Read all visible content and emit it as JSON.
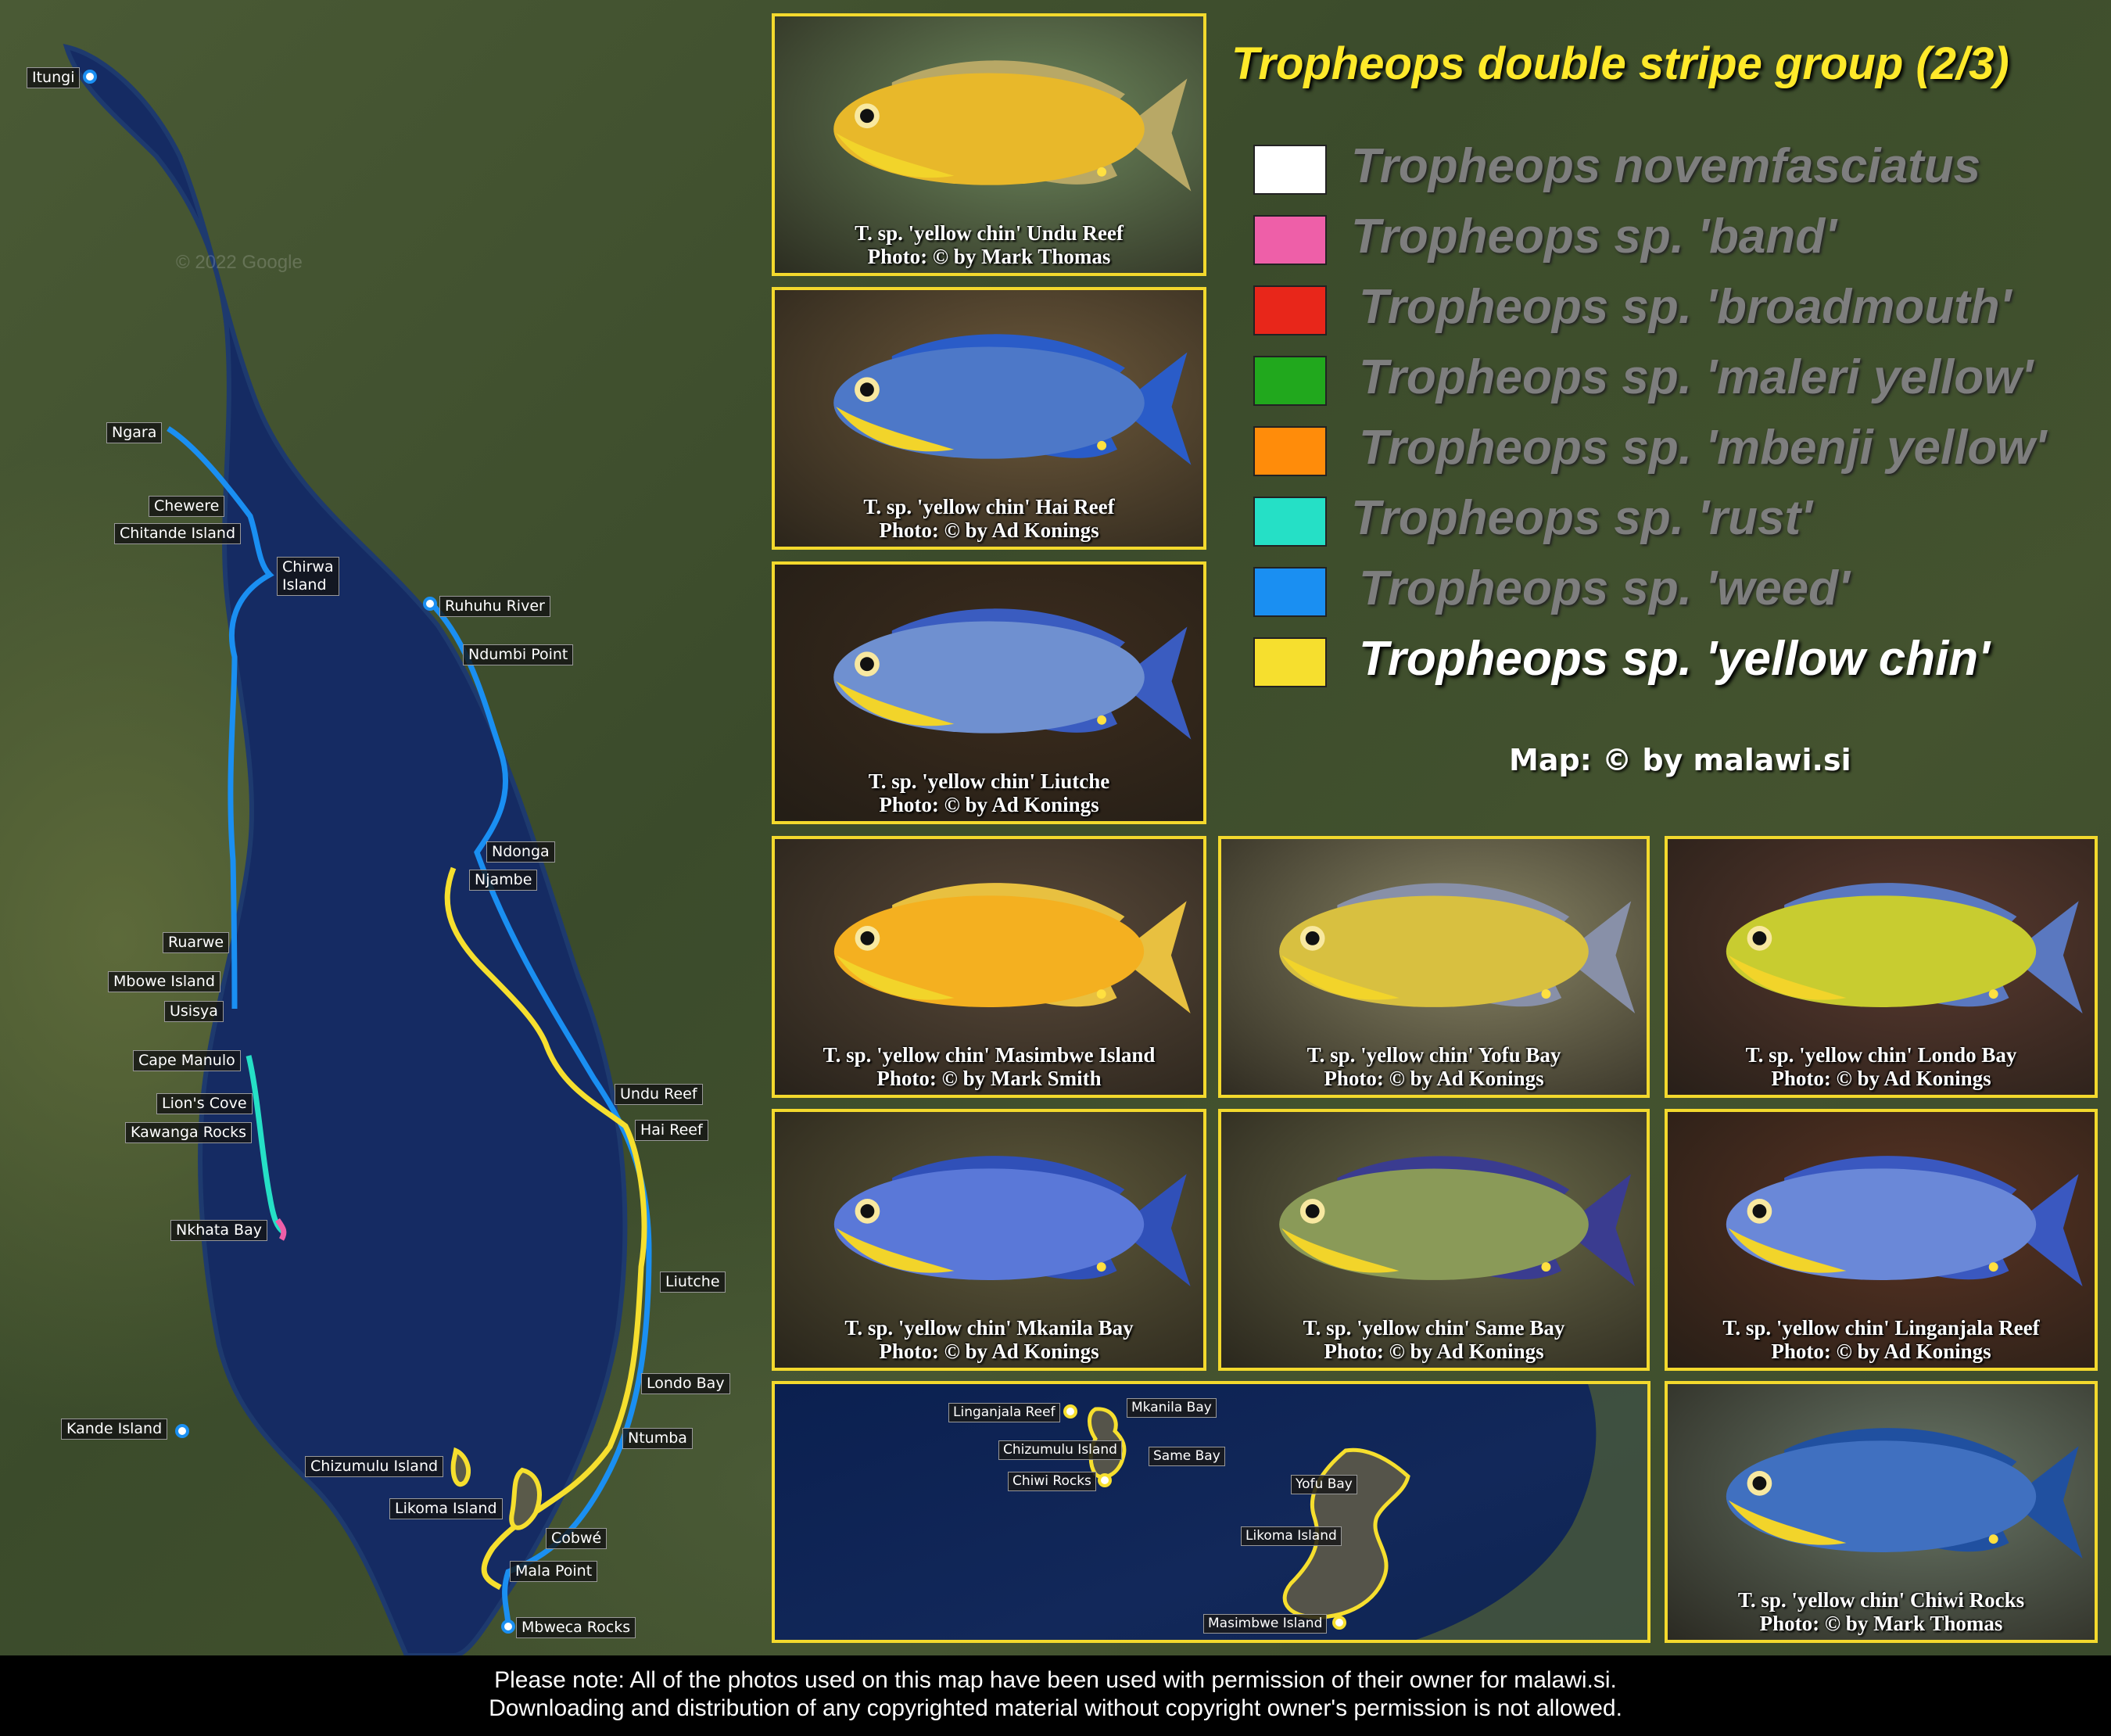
{
  "title": "Tropheops double stripe group (2/3)",
  "map_credit": "Map: © by malawi.si",
  "watermark": "© 2022 Google",
  "legend": [
    {
      "label": "Tropheops novemfasciatus",
      "color": "#ffffff",
      "active": false
    },
    {
      "label": "Tropheops sp. 'band'",
      "color": "#ee5fa8",
      "active": false
    },
    {
      "label": "Tropheops sp. 'broadmouth'",
      "color": "#e8261a",
      "active": false
    },
    {
      "label": "Tropheops sp. 'maleri yellow'",
      "color": "#21a81d",
      "active": false
    },
    {
      "label": "Tropheops sp. 'mbenji yellow'",
      "color": "#ff8c0a",
      "active": false
    },
    {
      "label": "Tropheops sp. 'rust'",
      "color": "#25e0c6",
      "active": false
    },
    {
      "label": "Tropheops sp. 'weed'",
      "color": "#1a8ff2",
      "active": false
    },
    {
      "label": "Tropheops sp. 'yellow chin'",
      "color": "#f6df2e",
      "active": true
    }
  ],
  "map_labels": {
    "itungi": "Itungi",
    "ngara": "Ngara",
    "chewere": "Chewere",
    "chitande": "Chitande Island",
    "chirwa": "Chirwa\nIsland",
    "ruarwe": "Ruarwe",
    "mbowe": "Mbowe Island",
    "usisya": "Usisya",
    "cape_manulo": "Cape Manulo",
    "lions_cove": "Lion's Cove",
    "kawanga": "Kawanga Rocks",
    "nkhata": "Nkhata Bay",
    "kande": "Kande Island",
    "chizumulu": "Chizumulu Island",
    "likoma": "Likoma Island",
    "ruhuhu": "Ruhuhu River",
    "ndumbi": "Ndumbi Point",
    "ndonga": "Ndonga",
    "njambe": "Njambe",
    "undu": "Undu Reef",
    "hai": "Hai Reef",
    "liutche": "Liutche",
    "londo": "Londo Bay",
    "ntumba": "Ntumba",
    "cobwe": "Cobwé",
    "mala": "Mala Point",
    "mbweca": "Mbweca Rocks"
  },
  "inset_labels": {
    "linganjala": "Linganjala Reef",
    "mkanila": "Mkanila Bay",
    "chizumulu": "Chizumulu Island",
    "same": "Same Bay",
    "chiwi": "Chiwi Rocks",
    "yofu": "Yofu Bay",
    "likoma": "Likoma Island",
    "masimbwe": "Masimbwe Island"
  },
  "photos": [
    {
      "caption": "T. sp. 'yellow chin' Undu Reef",
      "credit": "Photo: © by Mark Thomas",
      "body": "#e8b82a",
      "fin": "#b8a866",
      "bg": "#6f8a5e"
    },
    {
      "caption": "T. sp. 'yellow chin' Hai Reef",
      "credit": "Photo: © by Ad Konings",
      "body": "#4d78c8",
      "fin": "#2a5cc8",
      "bg": "#6e5a3c"
    },
    {
      "caption": "T. sp. 'yellow chin' Liutche",
      "credit": "Photo: © by Ad Konings",
      "body": "#6f90d0",
      "fin": "#3a5cc0",
      "bg": "#3d2d1e"
    },
    {
      "caption": "T. sp. 'yellow chin' Masimbwe Island",
      "credit": "Photo: © by Mark Smith",
      "body": "#f4b020",
      "fin": "#e8c040",
      "bg": "#5a4a3a"
    },
    {
      "caption": "T. sp. 'yellow chin' Yofu Bay",
      "credit": "Photo: © by Ad Konings",
      "body": "#d8c040",
      "fin": "#8890a8",
      "bg": "#8a8666"
    },
    {
      "caption": "T. sp. 'yellow chin' Londo Bay",
      "credit": "Photo: © by Ad Konings",
      "body": "#c8cc30",
      "fin": "#5a78c0",
      "bg": "#5a3a30"
    },
    {
      "caption": "T. sp. 'yellow chin' Mkanila Bay",
      "credit": "Photo: © by Ad Konings",
      "body": "#5a78d8",
      "fin": "#3050b8",
      "bg": "#5f5a3c"
    },
    {
      "caption": "T. sp. 'yellow chin' Same Bay",
      "credit": "Photo: © by Ad Konings",
      "body": "#8a9a58",
      "fin": "#3a3c90",
      "bg": "#6a6a4a"
    },
    {
      "caption": "T. sp. 'yellow chin' Linganjala Reef",
      "credit": "Photo: © by Ad Konings",
      "body": "#6a88d8",
      "fin": "#3a58c0",
      "bg": "#5a3424"
    },
    {
      "caption": "T. sp. 'yellow chin' Chiwi Rocks",
      "credit": "Photo: © by Mark Thomas",
      "body": "#4070c0",
      "fin": "#2050a0",
      "bg": "#6a7868"
    }
  ],
  "footer": {
    "line1": "Please note: All of the photos used on this map have been used with permission of their owner for malawi.si.",
    "line2": "Downloading and distribution of any copyrighted material without copyright owner's permission is not allowed."
  }
}
